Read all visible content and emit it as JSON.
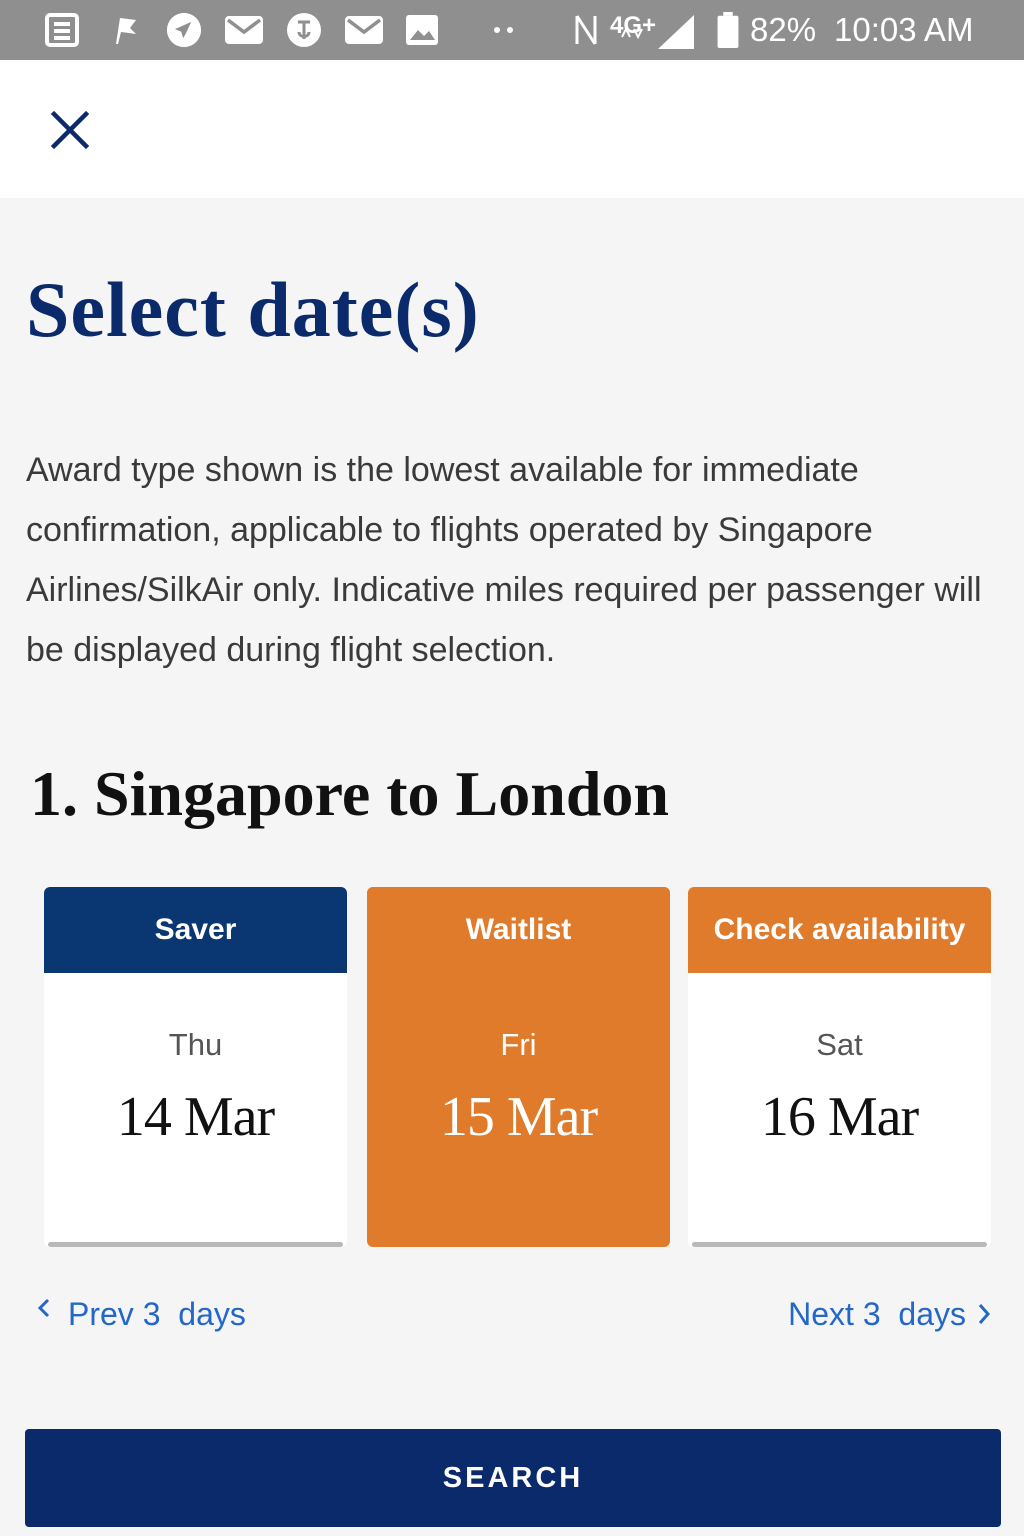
{
  "status_bar": {
    "network": "4G+",
    "battery": "82%",
    "time": "10:03 AM"
  },
  "page": {
    "title": "Select date(s)",
    "description": "Award type shown is the lowest available for immediate confirmation, applicable to flights operated by Singapore Airlines/SilkAir only. Indicative miles required per passenger will be displayed during flight selection.",
    "route": "1. Singapore to London"
  },
  "dates": [
    {
      "label": "Saver",
      "day": "Thu",
      "date": "14 Mar",
      "header_color": "#0a3772",
      "selected": false
    },
    {
      "label": "Waitlist",
      "day": "Fri",
      "date": "15 Mar",
      "header_color": "#df7b2a",
      "selected": true
    },
    {
      "label": "Check availability",
      "day": "Sat",
      "date": "16 Mar",
      "header_color": "#df7b2a",
      "selected": false
    }
  ],
  "nav": {
    "prev": "Prev 3  days",
    "next": "Next 3  days"
  },
  "search_label": "SEARCH",
  "colors": {
    "brand_navy": "#0b2a6b",
    "accent_orange": "#df7b2a",
    "link_blue": "#2367c8"
  }
}
